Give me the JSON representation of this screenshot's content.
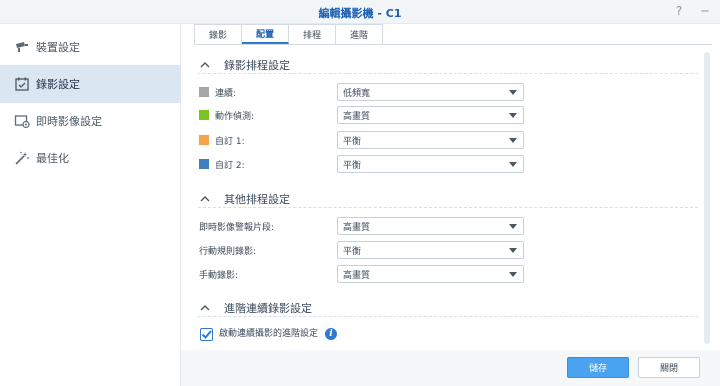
{
  "window": {
    "title": "編輯攝影機 - C1",
    "help_glyph": "?",
    "minimize_glyph": "─"
  },
  "sidebar": {
    "items": [
      {
        "label": "裝置設定",
        "icon": "camera-icon",
        "active": false
      },
      {
        "label": "錄影設定",
        "icon": "calendar-icon",
        "active": true
      },
      {
        "label": "即時影像設定",
        "icon": "live-view-icon",
        "active": false
      },
      {
        "label": "最佳化",
        "icon": "magic-wand-icon",
        "active": false
      }
    ]
  },
  "tabs": [
    {
      "label": "錄影",
      "active": false
    },
    {
      "label": "配置",
      "active": true
    },
    {
      "label": "排程",
      "active": false
    },
    {
      "label": "進階",
      "active": false
    }
  ],
  "sections": {
    "schedule": {
      "title": "錄影排程設定",
      "rows": [
        {
          "label": "連續:",
          "color": "#a6a6a6",
          "value": "低頻寬"
        },
        {
          "label": "動作偵測:",
          "color": "#7bc320",
          "value": "高畫質"
        },
        {
          "label": "自訂 1:",
          "color": "#f5a34a",
          "value": "平衡"
        },
        {
          "label": "自訂 2:",
          "color": "#3f7fc0",
          "value": "平衡"
        }
      ]
    },
    "other": {
      "title": "其他排程設定",
      "rows": [
        {
          "label": "即時影像警報片段:",
          "value": "高畫質"
        },
        {
          "label": "行動規則錄影:",
          "value": "平衡"
        },
        {
          "label": "手動錄影:",
          "value": "高畫質"
        }
      ]
    },
    "advanced": {
      "title": "進階連續錄影設定",
      "checkbox_label": "啟動連續攝影的進階設定",
      "checked": true,
      "info_glyph": "i"
    }
  },
  "footer": {
    "save_label": "儲存",
    "close_label": "關閉"
  },
  "colors": {
    "accent": "#2f7ad0",
    "title": "#1b5fb3",
    "primary_button": "#4aa3f0",
    "sidebar_active": "#dbe6f3"
  }
}
